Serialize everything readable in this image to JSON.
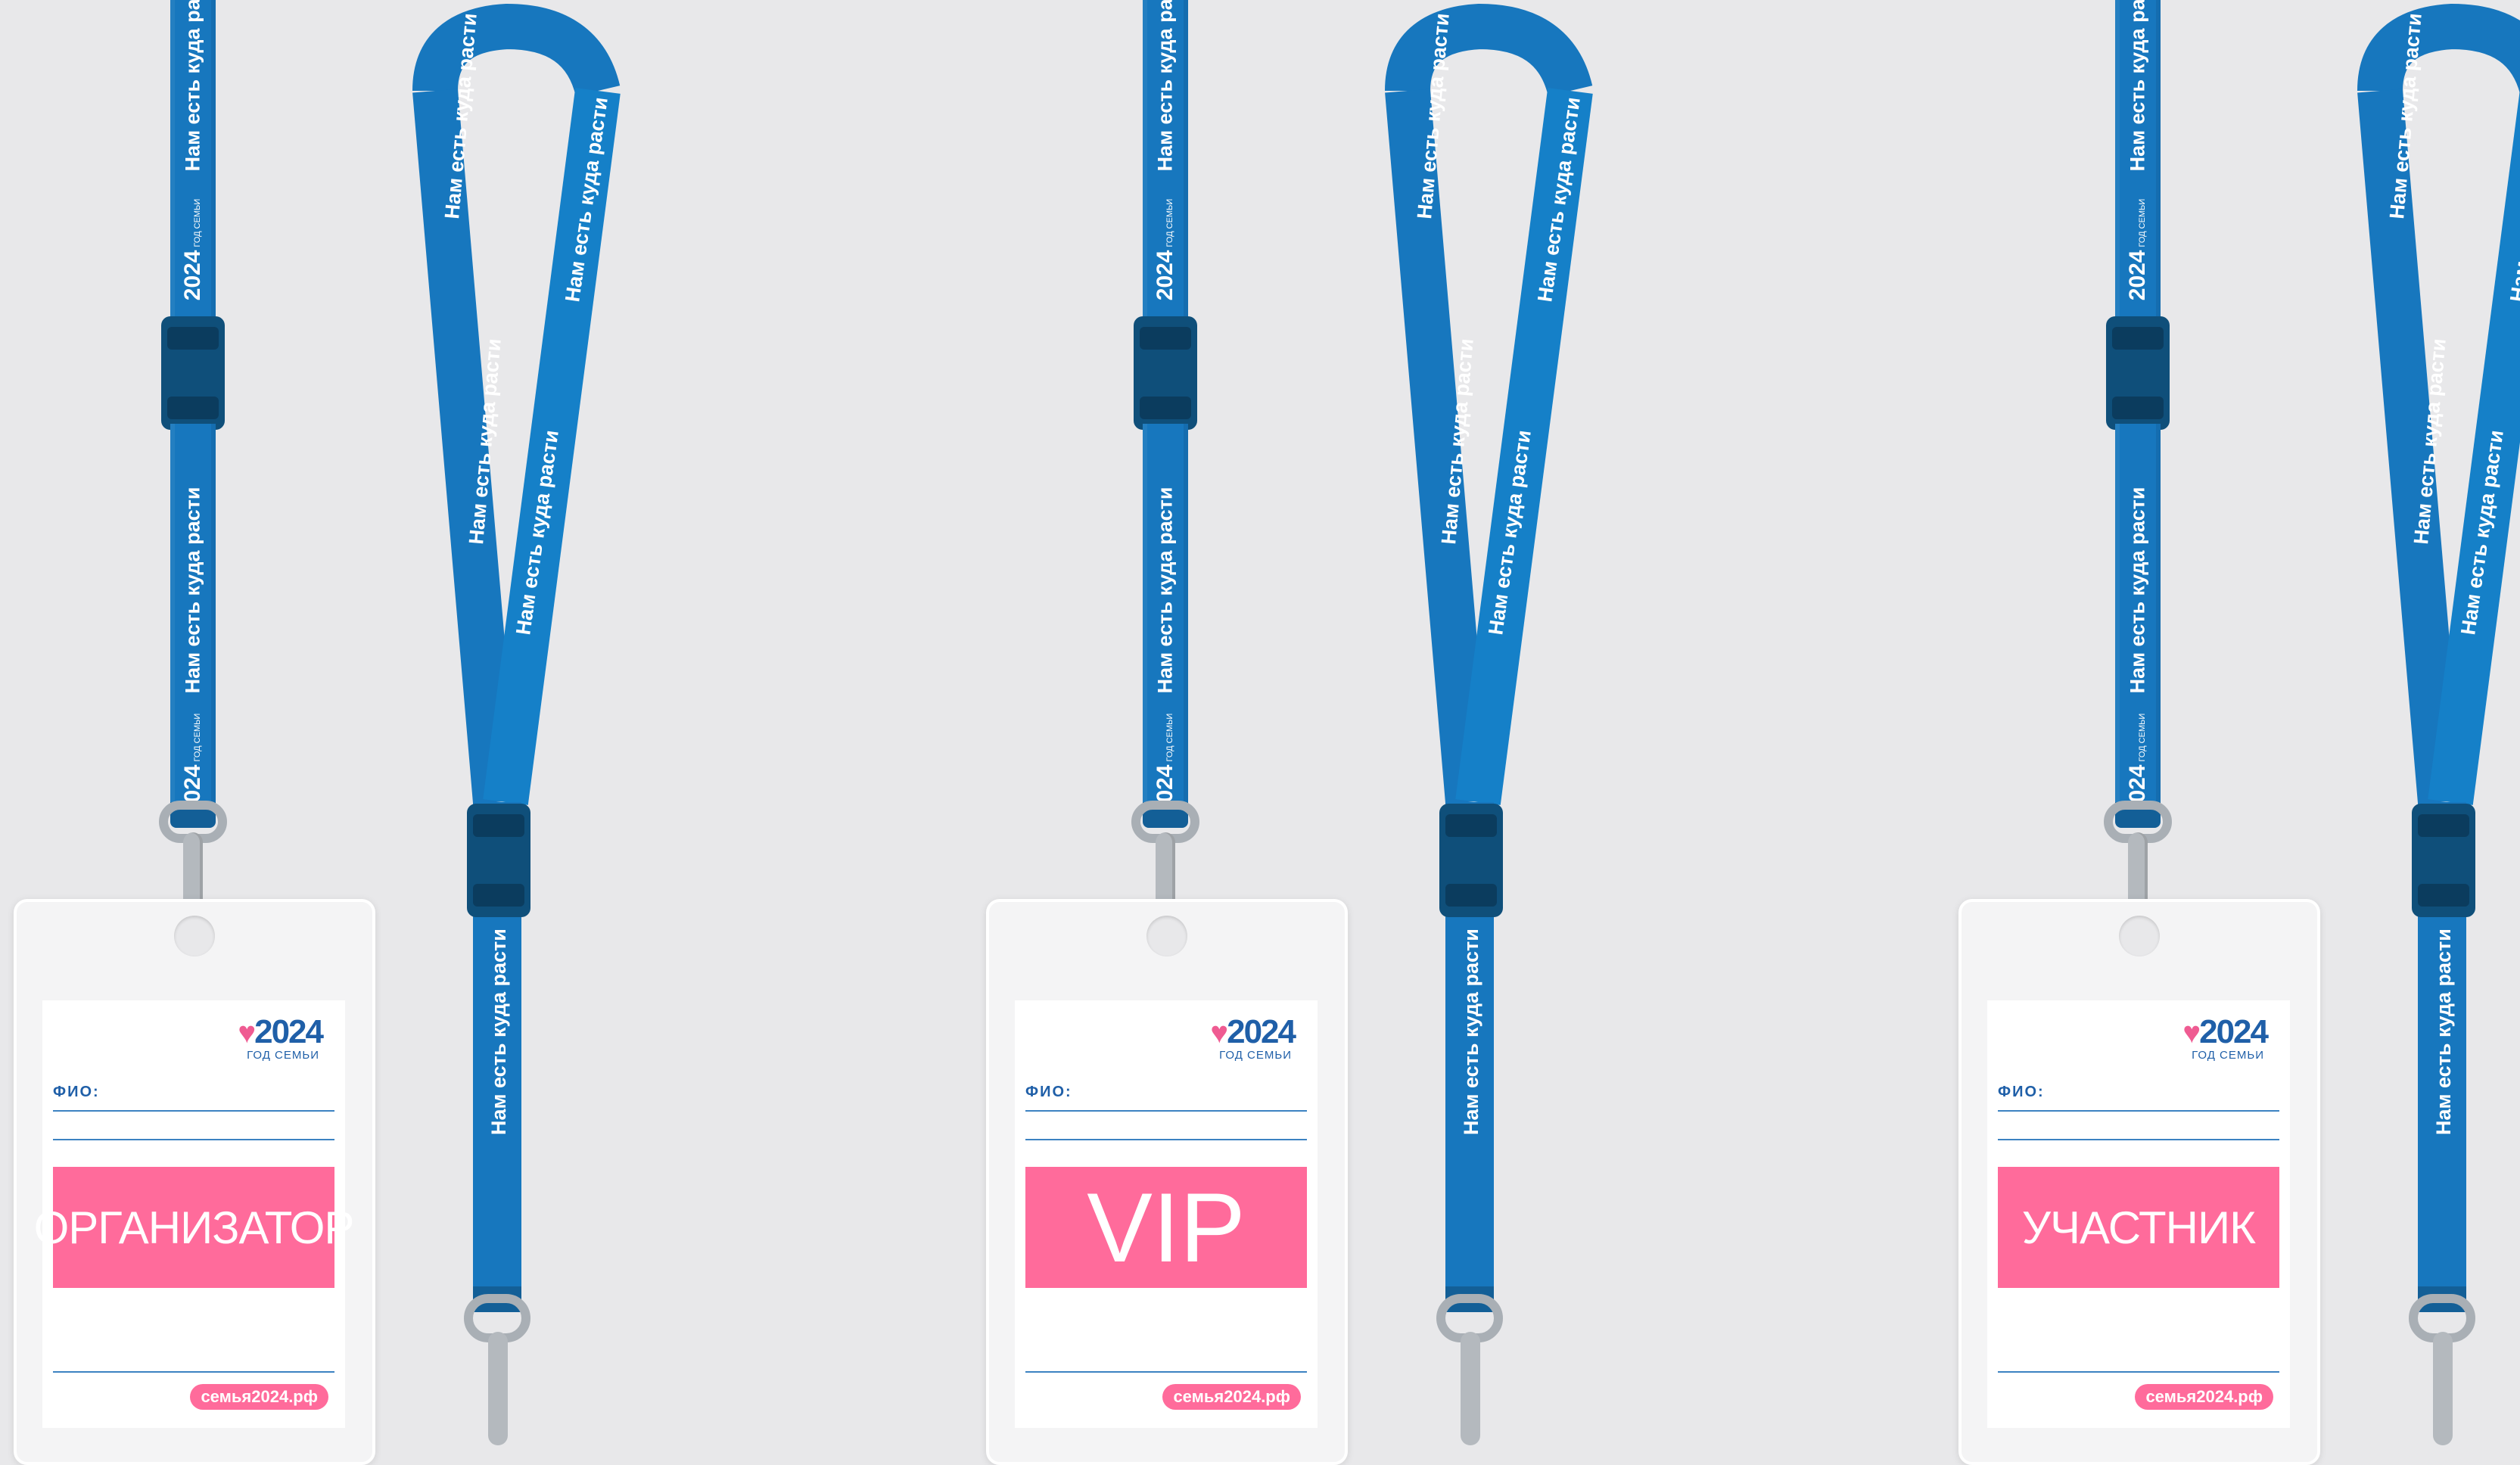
{
  "lanyard": {
    "slogan": "Нам есть куда расти",
    "logo_year": "2024",
    "logo_sub": "ГОД СЕМЬИ"
  },
  "badges": [
    {
      "logo_year": "2024",
      "logo_sub": "ГОД СЕМЬИ",
      "fio_label": "ФИО:",
      "role": "ОРГАНИЗАТОР",
      "site": "семья2024.рф"
    },
    {
      "logo_year": "2024",
      "logo_sub": "ГОД СЕМЬИ",
      "fio_label": "ФИО:",
      "role": "VIP",
      "site": "семья2024.рф"
    },
    {
      "logo_year": "2024",
      "logo_sub": "ГОД СЕМЬИ",
      "fio_label": "ФИО:",
      "role": "УЧАСТНИК",
      "site": "семья2024.рф"
    }
  ],
  "colors": {
    "background": "#e8e8ea",
    "lanyard_blue": "#1777be",
    "buckle_dark": "#0f4f7a",
    "brand_pink": "#ff6b9b",
    "logo_blue": "#1f5fa8"
  }
}
